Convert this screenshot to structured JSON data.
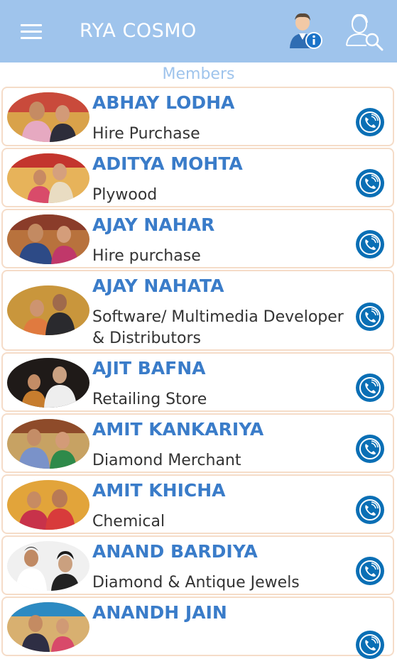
{
  "app": {
    "title": "RYA COSMO"
  },
  "header_icons": [
    "menu-icon",
    "member-info-icon",
    "search-member-icon"
  ],
  "section_title": "Members",
  "colors": {
    "appbar": "#9fc4ec",
    "name": "#3a7cc9",
    "call": "#0a6fb5",
    "card_border": "#f5dcc8"
  },
  "members": [
    {
      "name": "ABHAY LODHA",
      "business": "Hire Purchase"
    },
    {
      "name": "ADITYA MOHTA",
      "business": "Plywood"
    },
    {
      "name": "AJAY NAHAR",
      "business": "Hire purchase"
    },
    {
      "name": "AJAY NAHATA",
      "business": "Software/ Multimedia Developer & Distributors"
    },
    {
      "name": "AJIT BAFNA",
      "business": "Retailing Store"
    },
    {
      "name": "AMIT KANKARIYA",
      "business": "Diamond Merchant"
    },
    {
      "name": "AMIT KHICHA",
      "business": "Chemical"
    },
    {
      "name": "ANAND BARDIYA",
      "business": "Diamond & Antique Jewels"
    },
    {
      "name": "ANANDH JAIN",
      "business": ""
    }
  ]
}
